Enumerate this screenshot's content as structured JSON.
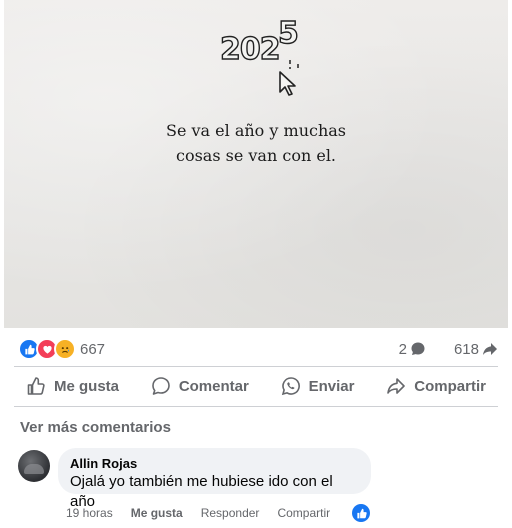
{
  "post": {
    "image": {
      "year_digits": "202",
      "year_last_digit": "5",
      "quote_line1": "Se va el año y muchas",
      "quote_line2": "cosas se van con el."
    },
    "reactions": {
      "types": [
        "like",
        "love",
        "sad"
      ],
      "count": "667",
      "comments_count": "2",
      "shares_count": "618"
    },
    "actions": {
      "like": "Me gusta",
      "comment": "Comentar",
      "send": "Enviar",
      "share": "Compartir"
    },
    "more_comments_label": "Ver más comentarios"
  },
  "comment": {
    "author": "Allin Rojas",
    "text": "Ojalá yo también me hubiese ido con el año",
    "time": "19 horas",
    "like_label": "Me gusta",
    "reply_label": "Responder",
    "share_label": "Compartir"
  },
  "colors": {
    "facebook_blue": "#1877f2",
    "love_red": "#f33e58",
    "sad_yellow": "#f7b125",
    "secondary_text": "#65676b"
  }
}
